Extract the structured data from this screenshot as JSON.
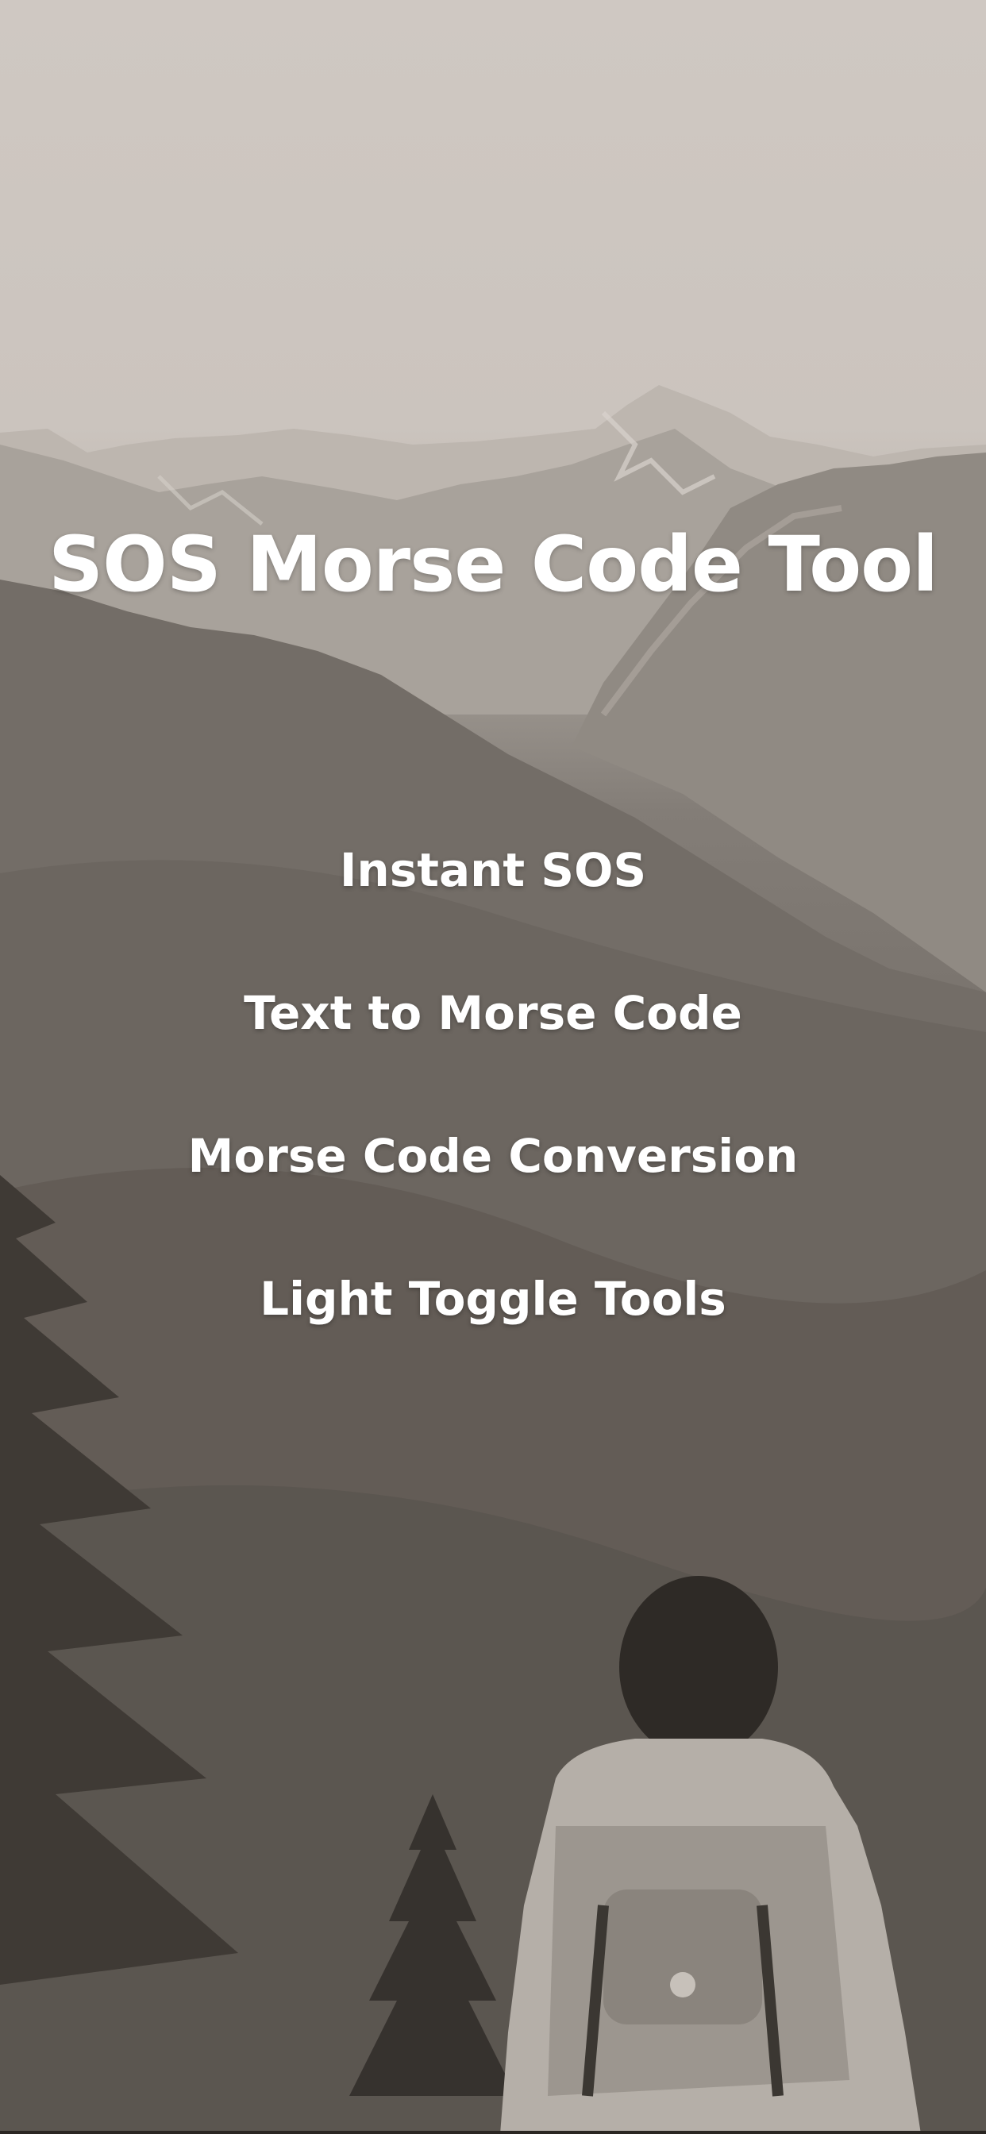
{
  "app": {
    "title": "SOS Morse Code Tool"
  },
  "menu": {
    "items": [
      {
        "label": "Instant SOS"
      },
      {
        "label": "Text to Morse Code"
      },
      {
        "label": "Morse Code Conversion"
      },
      {
        "label": "Light Toggle Tools"
      }
    ]
  },
  "background": {
    "description_icon": "mountain-landscape-photo",
    "tint": "#cdc6bf"
  }
}
